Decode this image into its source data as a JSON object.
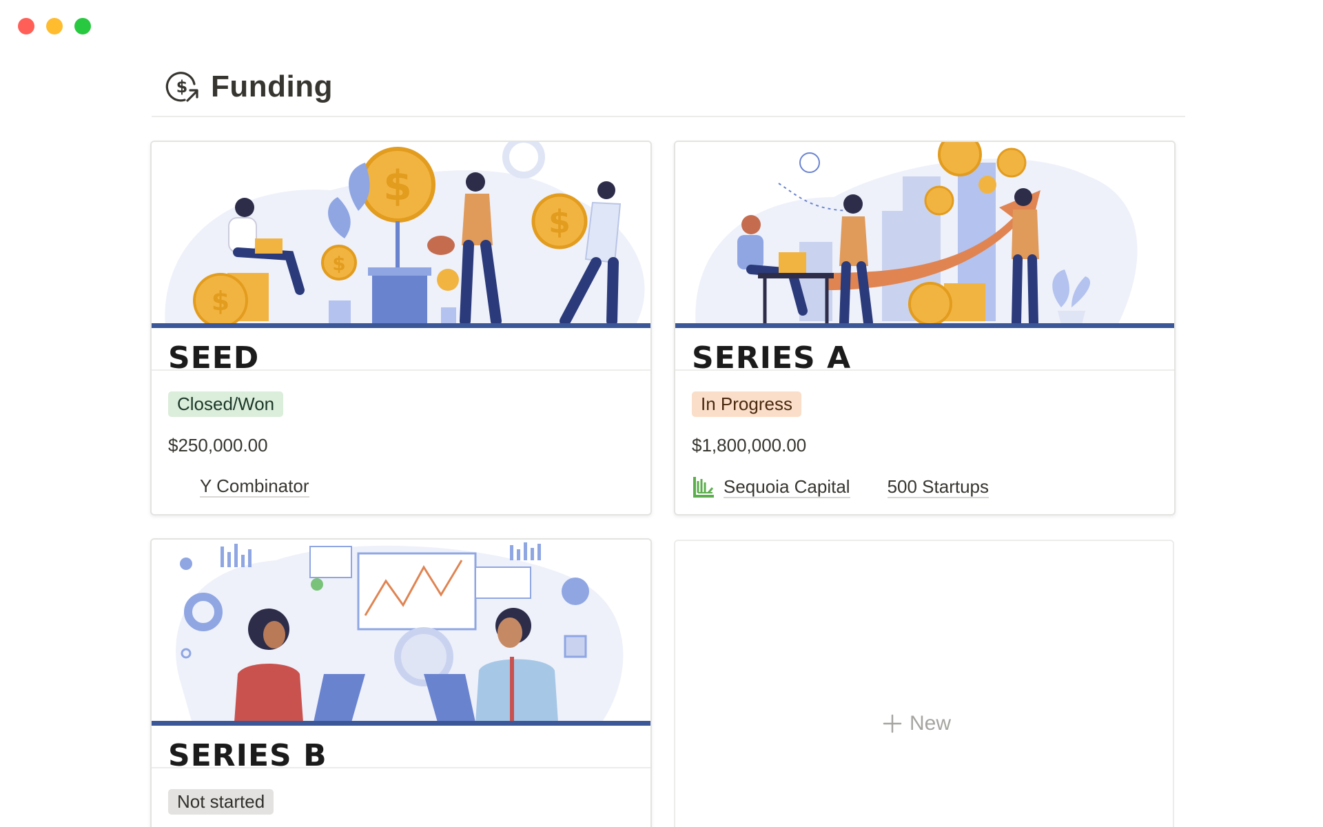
{
  "window": {
    "traffic_lights": [
      "close",
      "minimize",
      "zoom"
    ]
  },
  "page": {
    "title": "Funding",
    "icon": "dollar-refresh-icon"
  },
  "cards": [
    {
      "stage": "SEED",
      "status": "Closed/Won",
      "status_color": "#dbeddb",
      "amount": "$250,000.00",
      "investors": [
        {
          "name": "Y Combinator",
          "icon": "none"
        }
      ],
      "cover": "illustration-coins-plants"
    },
    {
      "stage": "SERIES A",
      "status": "In Progress",
      "status_color": "#fadec9",
      "amount": "$1,800,000.00",
      "investors": [
        {
          "name": "Sequoia Capital",
          "icon": "sequoia-logo-icon"
        },
        {
          "name": "500 Startups",
          "icon": "none"
        }
      ],
      "cover": "illustration-growth-arrow"
    },
    {
      "stage": "SERIES B",
      "status": "Not started",
      "status_color": "#e3e2e0",
      "cover": "illustration-analytics-team"
    }
  ],
  "new_card": {
    "label": "New",
    "icon": "plus-icon"
  },
  "colors": {
    "accent_bar": "#3b5797",
    "coin": "#f2b441",
    "plant": "#8fa6e3"
  }
}
